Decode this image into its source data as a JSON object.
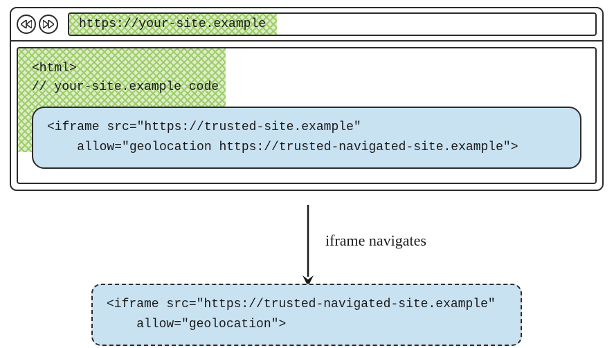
{
  "browser": {
    "address": "https://your-site.example"
  },
  "page": {
    "code_line1": "<html>",
    "code_line2": "// your-site.example code"
  },
  "iframe_before": {
    "line1": "<iframe src=\"https://trusted-site.example\"",
    "line2": "    allow=\"geolocation https://trusted-navigated-site.example\">"
  },
  "arrow_label": "iframe navigates",
  "iframe_after": {
    "line1": "<iframe src=\"https://trusted-navigated-site.example\"",
    "line2": "    allow=\"geolocation\">"
  },
  "colors": {
    "hatch_green_a": "#aed581",
    "hatch_green_b": "#dcedc8",
    "iframe_blue": "#c9e2f2",
    "border": "#2b2b2b"
  }
}
